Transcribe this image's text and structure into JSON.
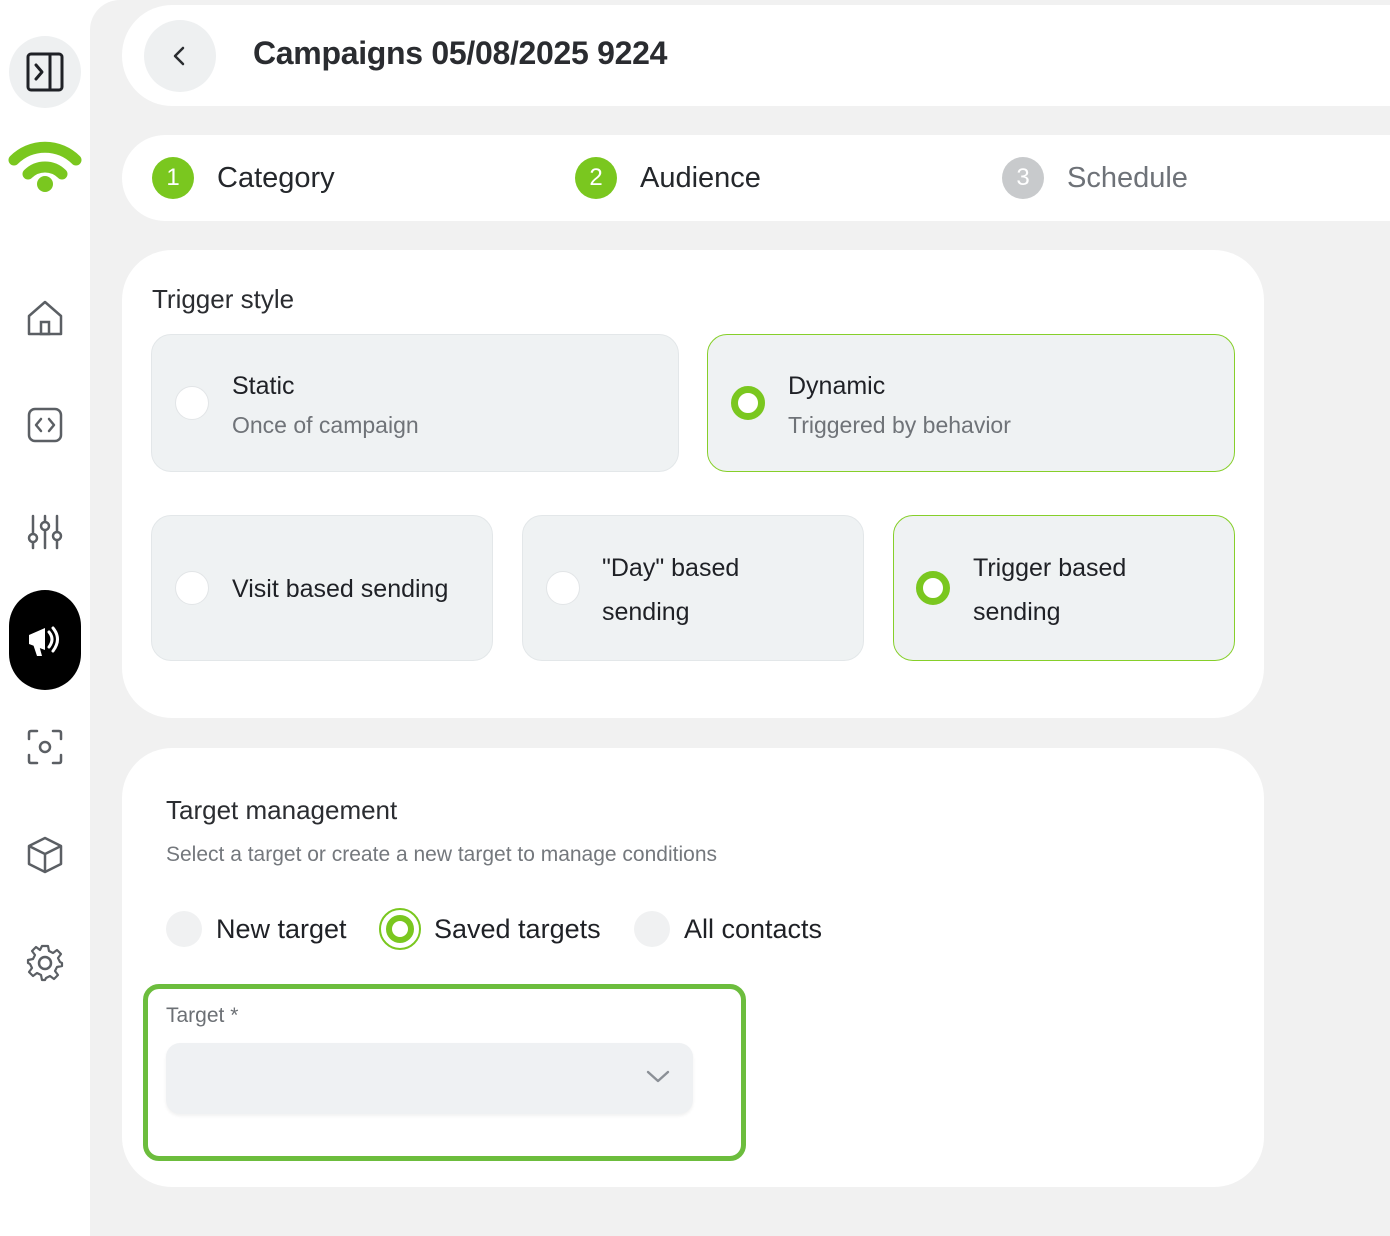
{
  "header": {
    "title": "Campaigns 05/08/2025 9224"
  },
  "steps": [
    {
      "num": "1",
      "label": "Category",
      "state": "done"
    },
    {
      "num": "2",
      "label": "Audience",
      "state": "active"
    },
    {
      "num": "3",
      "label": "Schedule",
      "state": "pending"
    }
  ],
  "trigger_style": {
    "title": "Trigger style",
    "options": [
      {
        "title": "Static",
        "subtitle": "Once of campaign",
        "selected": false
      },
      {
        "title": "Dynamic",
        "subtitle": "Triggered by behavior",
        "selected": true
      }
    ],
    "modes": [
      {
        "line1": "Visit based sending",
        "line2": "",
        "selected": false
      },
      {
        "line1": "\"Day\" based",
        "line2": "sending",
        "selected": false
      },
      {
        "line1": "Trigger based",
        "line2": "sending",
        "selected": true
      }
    ]
  },
  "target_management": {
    "title": "Target management",
    "subtitle": "Select a target or create a new target to manage conditions",
    "choices": [
      {
        "label": "New target",
        "selected": false
      },
      {
        "label": "Saved targets",
        "selected": true
      },
      {
        "label": "All contacts",
        "selected": false
      }
    ],
    "field_label": "Target *",
    "field_value": ""
  },
  "sidebar": {
    "items": [
      "home-icon",
      "code-icon",
      "sliders-icon",
      "megaphone-icon",
      "scan-icon",
      "cube-icon",
      "settings-icon"
    ],
    "active": "megaphone-icon"
  },
  "colors": {
    "accent": "#7ac71f",
    "highlight": "#6cbd3d",
    "background": "#f1f1f1"
  }
}
